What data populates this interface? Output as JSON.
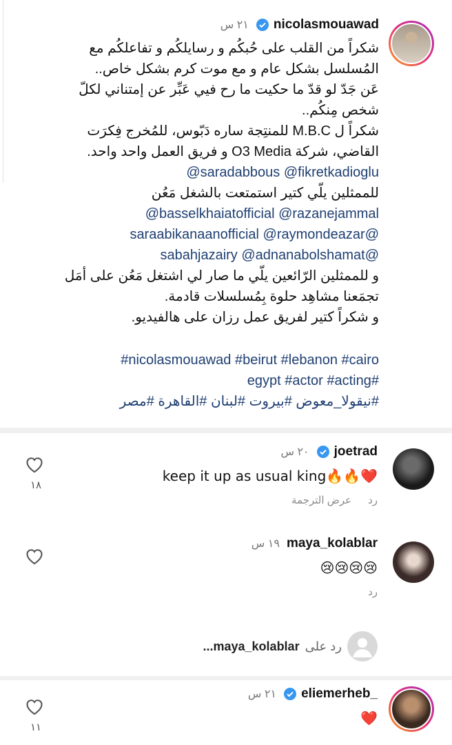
{
  "caption": {
    "username": "nicolasmouawad",
    "time": "٢١ س",
    "lines": [
      "شكراً من القلب على حُبكُم و رسايلكُم و تفاعلكُم مع",
      "المُسلسل بشكل عام و مع موت كرم بشكل خاص..",
      "عَن جَدّ لو قدّ ما حكيت ما رح فيي عَبِّر عن إمتناني لكلّ",
      "شخص مِنكُم..",
      "شكراً ل M.B.C للمنتِجة ساره دَبّوس، للمُخرج فِكرَت",
      "القاضي، شركة O3 Media و فريق العمل واحد واحد."
    ],
    "mention_line_1": "saradabbous @fikretkadioglu@",
    "text_after_1": "للممثلين يلّي كتير استمتعت بالشغل مَعُن",
    "mention_line_2": "basselkhaiatofficial  @razanejammal@",
    "mention_line_3": "@saraabikanaanofficial @raymondeazar",
    "mention_line_4": "@sabahjazairy @adnanabolshamat",
    "lines_2": [
      "و للممثلين الرّائعين يلّي ما صار لي اشتغل مَعُن على أمَل",
      "تجمَعنا مشاهِد حلوة بِمُسلسلات قادمة.",
      "و شكراً كتير لفريق عمل رزان على هالفيديو."
    ],
    "hashtag_line_1": "nicolasmouawad #beirut #lebanon #cairo#",
    "hashtag_line_2": "#egypt #actor #acting",
    "hashtag_line_3": "#نيقولا_معوض #بيروت #لبنان #القاهرة #مصر"
  },
  "comments": [
    {
      "username": "joetrad",
      "verified": true,
      "time": "٢٠ س",
      "text": "keep it up as usual king🔥🔥❤️",
      "reply_label": "رد",
      "translate_label": "عرض الترجمة",
      "likes": "١٨"
    },
    {
      "username": "maya_kolablar",
      "verified": false,
      "time": "١٩ س",
      "text": "😢😢😢😢",
      "reply_label": "رد",
      "likes": ""
    },
    {
      "username": "eliemerheb_",
      "verified": true,
      "time": "٢١ س",
      "text": "❤️",
      "likes": "١١"
    }
  ],
  "reply_field": {
    "prefix": "رد على",
    "target": "maya_kolablar..."
  },
  "colors": {
    "link": "#1f3f72",
    "verified": "#3897f0",
    "heart_red": "#e0245e"
  }
}
